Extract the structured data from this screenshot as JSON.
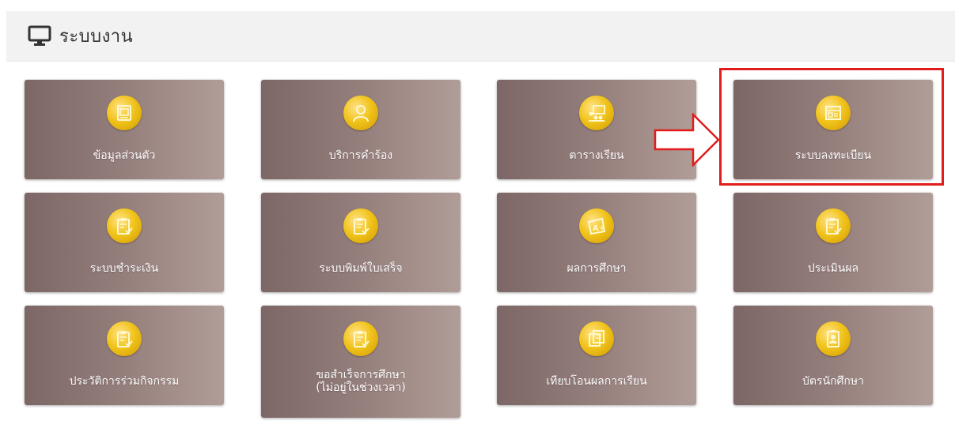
{
  "header": {
    "title": "ระบบงาน",
    "icon": "monitor-icon"
  },
  "tiles": [
    {
      "label": "ข้อมูลส่วนตัว",
      "icon": "profile-card-icon"
    },
    {
      "label": "บริการคำร้อง",
      "icon": "person-icon"
    },
    {
      "label": "ตารางเรียน",
      "icon": "classroom-icon"
    },
    {
      "label": "ระบบลงทะเบียน",
      "icon": "registration-form-icon"
    },
    {
      "label": "ระบบชำระเงิน",
      "icon": "clipboard-check-icon"
    },
    {
      "label": "ระบบพิมพ์ใบเสร็จ",
      "icon": "clipboard-check-icon"
    },
    {
      "label": "ผลการศึกษา",
      "icon": "grade-a-plus-icon"
    },
    {
      "label": "ประเมินผล",
      "icon": "clipboard-check-icon"
    },
    {
      "label": "ประวัติการร่วมกิจกรรม",
      "icon": "clipboard-check-icon"
    },
    {
      "label": "ขอสำเร็จการศึกษา",
      "label_sub": "(ไม่อยู่ในช่วงเวลา)",
      "icon": "clipboard-check-icon"
    },
    {
      "label": "เทียบโอนผลการเรียน",
      "icon": "documents-icon"
    },
    {
      "label": "บัตรนักศึกษา",
      "icon": "student-id-card-icon"
    }
  ],
  "annotation": {
    "highlight_color": "#e21b1b"
  },
  "colors": {
    "tile_left": "#7d6766",
    "tile_right": "#b19d97",
    "coin": "#f1c41c"
  }
}
